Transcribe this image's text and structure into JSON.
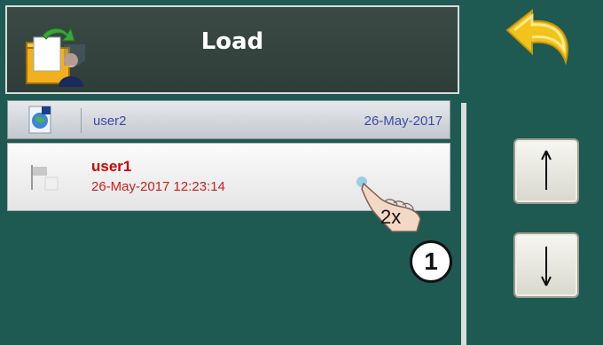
{
  "header": {
    "title": "Load",
    "icon": "folder-user-load-icon"
  },
  "toolbar": {
    "back_icon": "back-arrow-icon",
    "up_icon": "arrow-up-icon",
    "down_icon": "arrow-down-icon"
  },
  "list": {
    "items": [
      {
        "name": "user2",
        "date": "26-May-2017",
        "icon": "user-globe-icon",
        "selected": false
      },
      {
        "name": "user1",
        "date": "26-May-2017 12:23:14",
        "icon": "flag-icon",
        "selected": true
      }
    ]
  },
  "annotation": {
    "tap_text": "2x",
    "step_number": "1"
  },
  "colors": {
    "background": "#1e5a52",
    "header": "#36433f",
    "selected_text": "#cc0000",
    "item_text": "#3b4ba8",
    "back_arrow": "#f2c31a"
  }
}
